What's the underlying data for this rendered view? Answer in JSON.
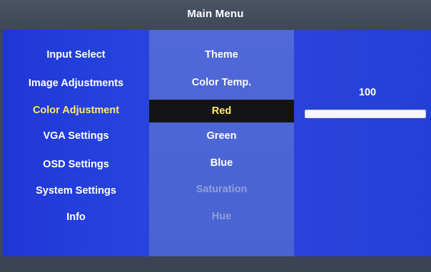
{
  "header": {
    "title": "Main Menu"
  },
  "main_menu": {
    "items": [
      {
        "label": "Input Select",
        "state": "normal"
      },
      {
        "label": "Image Adjustments",
        "state": "normal"
      },
      {
        "label": "Color Adjustment",
        "state": "active"
      },
      {
        "label": "VGA Settings",
        "state": "normal"
      },
      {
        "label": "OSD Settings",
        "state": "normal"
      },
      {
        "label": "System Settings",
        "state": "normal"
      },
      {
        "label": "Info",
        "state": "normal"
      }
    ]
  },
  "sub_menu": {
    "items": [
      {
        "label": "Theme",
        "state": "normal"
      },
      {
        "label": "Color Temp.",
        "state": "normal"
      },
      {
        "label": "Red",
        "state": "selected"
      },
      {
        "label": "Green",
        "state": "normal"
      },
      {
        "label": "Blue",
        "state": "normal"
      },
      {
        "label": "Saturation",
        "state": "disabled"
      },
      {
        "label": "Hue",
        "state": "disabled"
      }
    ]
  },
  "value_panel": {
    "value": "100",
    "slider_fraction": 1.0
  },
  "colors": {
    "highlight_text": "#ffe96a",
    "selection_bg": "#141417",
    "disabled_text": "#8f9fdc",
    "panel_blue": "#2440dc"
  }
}
